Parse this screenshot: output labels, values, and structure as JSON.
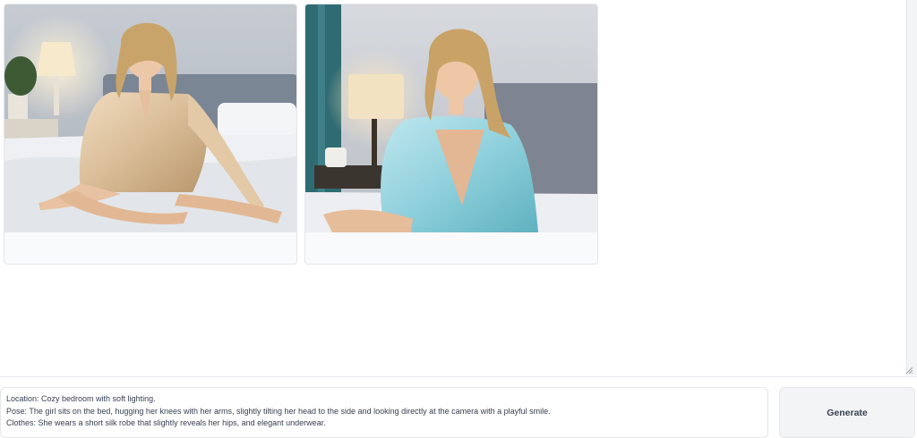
{
  "gallery": {
    "images": [
      {
        "name": "generated-image-1",
        "description": "bedroom portrait, champagne silk robe"
      },
      {
        "name": "generated-image-2",
        "description": "bedroom portrait, light-blue silk robe"
      }
    ]
  },
  "prompt": {
    "lines": [
      "Location: Cozy bedroom with soft lighting.",
      "Pose: The girl sits on the bed, hugging her knees with her arms, slightly tilting her head to the side and looking directly at the camera with a playful smile.",
      "Clothes: She wears a short silk robe that slightly reveals her hips, and elegant underwear."
    ]
  },
  "generate_label": "Generate",
  "colors": {
    "accent": "#f3f4f6",
    "border": "#e5e7eb",
    "text": "#374151"
  }
}
